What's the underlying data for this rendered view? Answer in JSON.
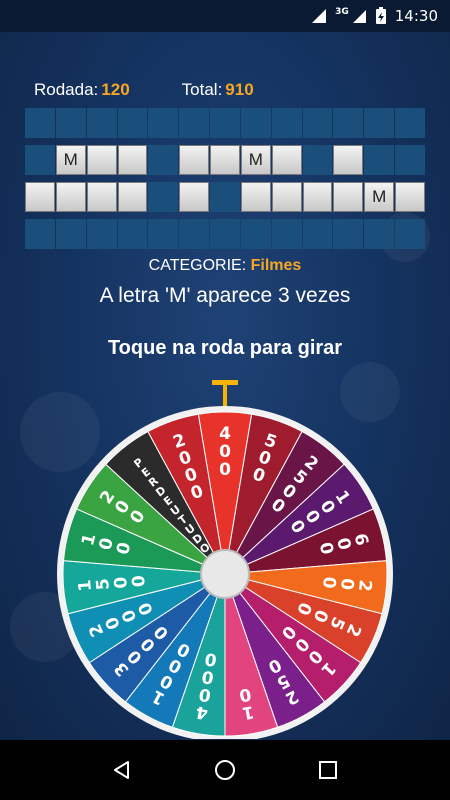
{
  "status": {
    "network": "3G",
    "time": "14:30",
    "icons": [
      "wifi-signal-icon",
      "cell-signal-icon",
      "battery-charging-icon"
    ]
  },
  "score": {
    "round_label": "Rodada:",
    "round_value": "120",
    "total_label": "Total:",
    "total_value": "910"
  },
  "board": {
    "rows": [
      [
        "",
        "",
        "",
        "",
        "",
        "",
        "",
        "",
        "",
        "",
        "",
        "",
        ""
      ],
      [
        "",
        "M",
        "_",
        "_",
        "",
        "_",
        "_",
        "M",
        "_",
        "",
        "_",
        "",
        ""
      ],
      [
        "_",
        "_",
        "_",
        "_",
        "",
        "_",
        "",
        "_",
        "_",
        "_",
        "_",
        "M",
        "_"
      ],
      [
        "",
        "",
        "",
        "",
        "",
        "",
        "",
        "",
        "",
        "",
        "",
        "",
        ""
      ]
    ]
  },
  "category": {
    "label": "CATEGORIE:",
    "value": "Filmes"
  },
  "message": "A letra 'M' aparece 3 vezes",
  "prompt": "Toque na roda para girar",
  "wheel": {
    "pointer_color": "#f6b400",
    "segments": [
      {
        "label": "400",
        "color": "#e8332a"
      },
      {
        "label": "500",
        "color": "#9e1c2e"
      },
      {
        "label": "2500",
        "color": "#6a1547"
      },
      {
        "label": "1000",
        "color": "#5b1a6e"
      },
      {
        "label": "600",
        "color": "#7a1230"
      },
      {
        "label": "200",
        "color": "#f26b1d"
      },
      {
        "label": "2500",
        "color": "#d9412b"
      },
      {
        "label": "1000",
        "color": "#b51e6b"
      },
      {
        "label": "250",
        "color": "#7b1f8a"
      },
      {
        "label": "10",
        "color": "#e2447f"
      },
      {
        "label": "4000",
        "color": "#1aa39a"
      },
      {
        "label": "1000",
        "color": "#1379b8"
      },
      {
        "label": "3000",
        "color": "#1d5ba6"
      },
      {
        "label": "2000",
        "color": "#0f8fb3"
      },
      {
        "label": "1500",
        "color": "#14a79a"
      },
      {
        "label": "100",
        "color": "#1b9a57"
      },
      {
        "label": "200",
        "color": "#3aa342"
      },
      {
        "label": "PERDEU TUDO",
        "color": "#2b2b2b"
      },
      {
        "label": "2000",
        "color": "#c4242b"
      }
    ]
  }
}
